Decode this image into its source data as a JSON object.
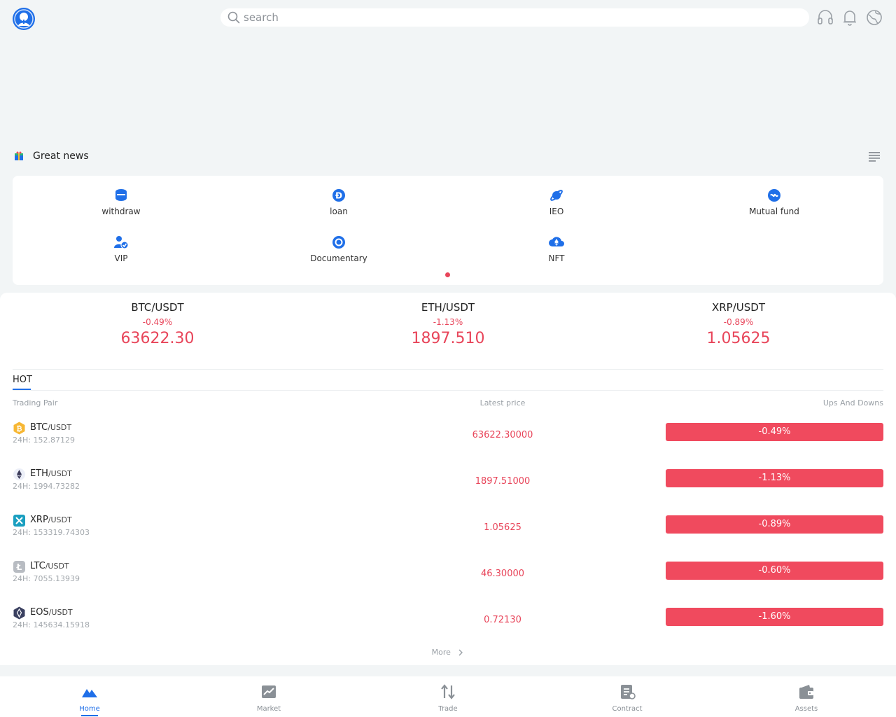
{
  "search": {
    "placeholder": "search"
  },
  "news": {
    "text": "Great news"
  },
  "quick_actions": [
    {
      "label": "withdraw",
      "icon": "withdraw-icon"
    },
    {
      "label": "loan",
      "icon": "loan-icon"
    },
    {
      "label": "IEO",
      "icon": "ieo-icon"
    },
    {
      "label": "Mutual fund",
      "icon": "mutual-fund-icon"
    },
    {
      "label": "VIP",
      "icon": "vip-icon"
    },
    {
      "label": "Documentary",
      "icon": "documentary-icon"
    },
    {
      "label": "NFT",
      "icon": "nft-icon"
    }
  ],
  "tickers": [
    {
      "pair": "BTC/USDT",
      "change": "-0.49%",
      "price": "63622.30"
    },
    {
      "pair": "ETH/USDT",
      "change": "-1.13%",
      "price": "1897.510"
    },
    {
      "pair": "XRP/USDT",
      "change": "-0.89%",
      "price": "1.05625"
    }
  ],
  "hot": {
    "tab": "HOT",
    "headers": {
      "pair": "Trading Pair",
      "price": "Latest price",
      "change": "Ups And Downs"
    },
    "rows": [
      {
        "base": "BTC",
        "quote": "/USDT",
        "volume": "24H: 152.87129",
        "price": "63622.30000",
        "change": "-0.49%",
        "icon": "bitcoin-icon"
      },
      {
        "base": "ETH",
        "quote": "/USDT",
        "volume": "24H: 1994.73282",
        "price": "1897.51000",
        "change": "-1.13%",
        "icon": "ethereum-icon"
      },
      {
        "base": "XRP",
        "quote": "/USDT",
        "volume": "24H: 153319.74303",
        "price": "1.05625",
        "change": "-0.89%",
        "icon": "xrp-icon"
      },
      {
        "base": "LTC",
        "quote": "/USDT",
        "volume": "24H: 7055.13939",
        "price": "46.30000",
        "change": "-0.60%",
        "icon": "litecoin-icon"
      },
      {
        "base": "EOS",
        "quote": "/USDT",
        "volume": "24H: 145634.15918",
        "price": "0.72130",
        "change": "-1.60%",
        "icon": "eos-icon"
      }
    ],
    "more": "More"
  },
  "nav": [
    {
      "label": "Home",
      "icon": "home-icon",
      "active": true
    },
    {
      "label": "Market",
      "icon": "market-icon"
    },
    {
      "label": "Trade",
      "icon": "trade-icon"
    },
    {
      "label": "Contract",
      "icon": "contract-icon"
    },
    {
      "label": "Assets",
      "icon": "assets-icon"
    }
  ],
  "colors": {
    "accent": "#1f6fe8",
    "down": "#f04a5e",
    "down_text": "#e8455a",
    "background": "#f2f5f6"
  }
}
